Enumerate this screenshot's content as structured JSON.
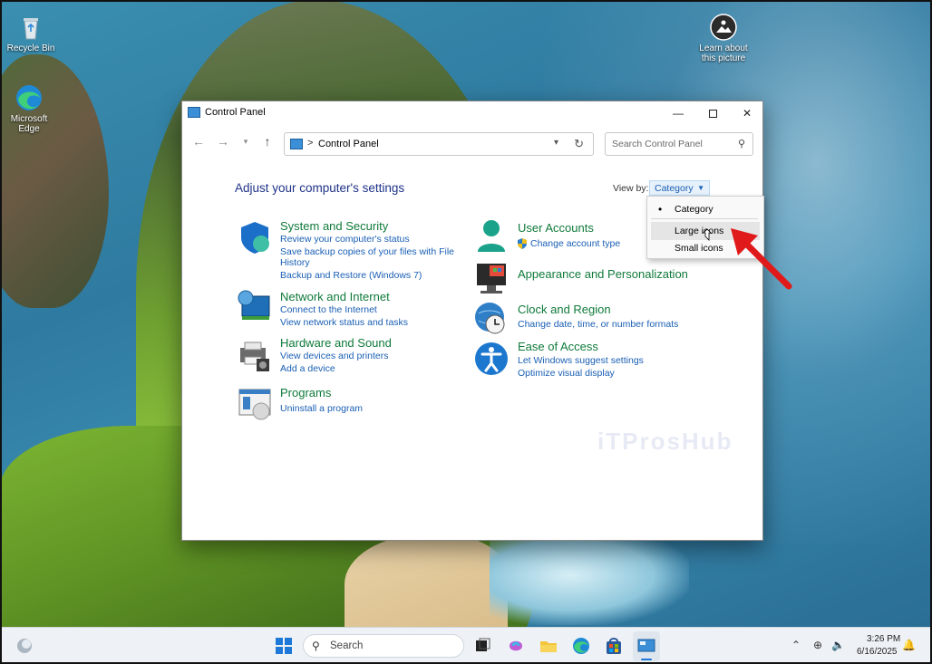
{
  "desktop": {
    "icons": [
      {
        "label": "Recycle Bin"
      },
      {
        "label": "Microsoft Edge"
      },
      {
        "label": "Learn about this picture"
      }
    ]
  },
  "window": {
    "title": "Control Panel",
    "address": {
      "separator": ">",
      "path": "Control Panel"
    },
    "search_placeholder": "Search Control Panel",
    "heading": "Adjust your computer's settings",
    "view_by": {
      "label": "View by:",
      "selected": "Category",
      "options": [
        "Category",
        "Large icons",
        "Small icons"
      ]
    },
    "categories": [
      {
        "title": "System and Security",
        "links": [
          "Review your computer's status",
          "Save backup copies of your files with File",
          "History",
          "Backup and Restore (Windows 7)"
        ]
      },
      {
        "title": "Network and Internet",
        "links": [
          "Connect to the Internet",
          "View network status and tasks"
        ]
      },
      {
        "title": "Hardware and Sound",
        "links": [
          "View devices and printers",
          "Add a device"
        ]
      },
      {
        "title": "Programs",
        "links": [
          "Uninstall a program"
        ]
      },
      {
        "title": "User Accounts",
        "links": [
          "Change account type"
        ]
      },
      {
        "title": "Appearance and Personalization",
        "links": []
      },
      {
        "title": "Clock and Region",
        "links": [
          "Change date, time, or number formats"
        ]
      },
      {
        "title": "Ease of Access",
        "links": [
          "Let Windows suggest settings",
          "Optimize visual display"
        ]
      }
    ]
  },
  "taskbar": {
    "search_label": "Search",
    "time": "3:26 PM",
    "date": "6/16/2025"
  },
  "colors": {
    "category_title": "#0f7a3a",
    "link": "#1a5fb4",
    "heading": "#1e3287",
    "arrow": "#e01a1a"
  }
}
